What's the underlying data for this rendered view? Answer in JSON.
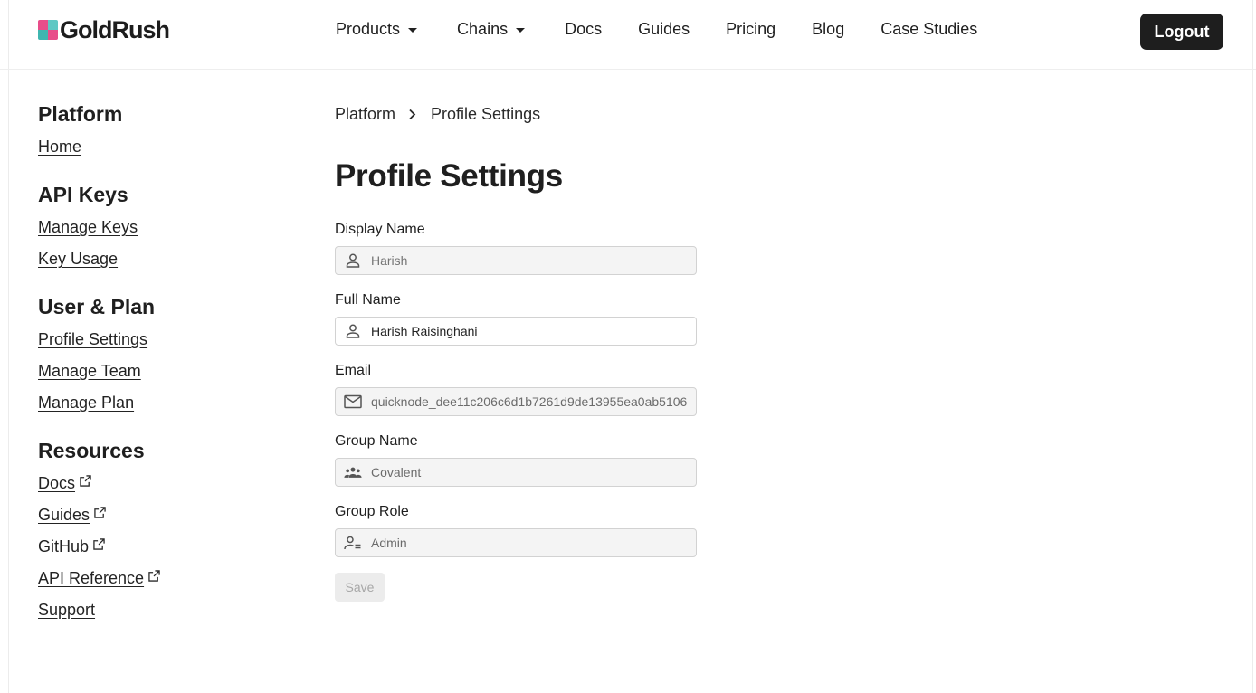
{
  "brand": {
    "name": "GoldRush",
    "logo_colors": [
      "#e84d8a",
      "#5ec8c4",
      "#f2a2c0",
      "#3fb6b0"
    ]
  },
  "nav": {
    "items": [
      {
        "label": "Products",
        "has_dropdown": true
      },
      {
        "label": "Chains",
        "has_dropdown": true
      },
      {
        "label": "Docs"
      },
      {
        "label": "Guides"
      },
      {
        "label": "Pricing"
      },
      {
        "label": "Blog"
      },
      {
        "label": "Case Studies"
      }
    ],
    "logout_label": "Logout"
  },
  "sidebar": {
    "groups": [
      {
        "heading": "Platform",
        "links": [
          {
            "label": "Home"
          }
        ]
      },
      {
        "heading": "API Keys",
        "links": [
          {
            "label": "Manage Keys"
          },
          {
            "label": "Key Usage"
          }
        ]
      },
      {
        "heading": "User & Plan",
        "links": [
          {
            "label": "Profile Settings"
          },
          {
            "label": "Manage Team"
          },
          {
            "label": "Manage Plan"
          }
        ]
      },
      {
        "heading": "Resources",
        "links": [
          {
            "label": "Docs",
            "external": true
          },
          {
            "label": "Guides",
            "external": true
          },
          {
            "label": "GitHub",
            "external": true
          },
          {
            "label": "API Reference",
            "external": true
          },
          {
            "label": "Support"
          }
        ]
      }
    ]
  },
  "breadcrumb": {
    "parent": "Platform",
    "current": "Profile Settings"
  },
  "page": {
    "title": "Profile Settings"
  },
  "form": {
    "display_name": {
      "label": "Display Name",
      "placeholder": "Harish",
      "value": "",
      "icon": "person-icon"
    },
    "full_name": {
      "label": "Full Name",
      "value": "Harish Raisinghani",
      "icon": "person-icon"
    },
    "email": {
      "label": "Email",
      "value": "quicknode_dee11c206c6d1b7261d9de13955ea0ab5106",
      "icon": "mail-icon"
    },
    "group_name": {
      "label": "Group Name",
      "value": "Covalent",
      "icon": "group-icon"
    },
    "group_role": {
      "label": "Group Role",
      "value": "Admin",
      "icon": "person-badge-icon"
    },
    "save_label": "Save"
  }
}
